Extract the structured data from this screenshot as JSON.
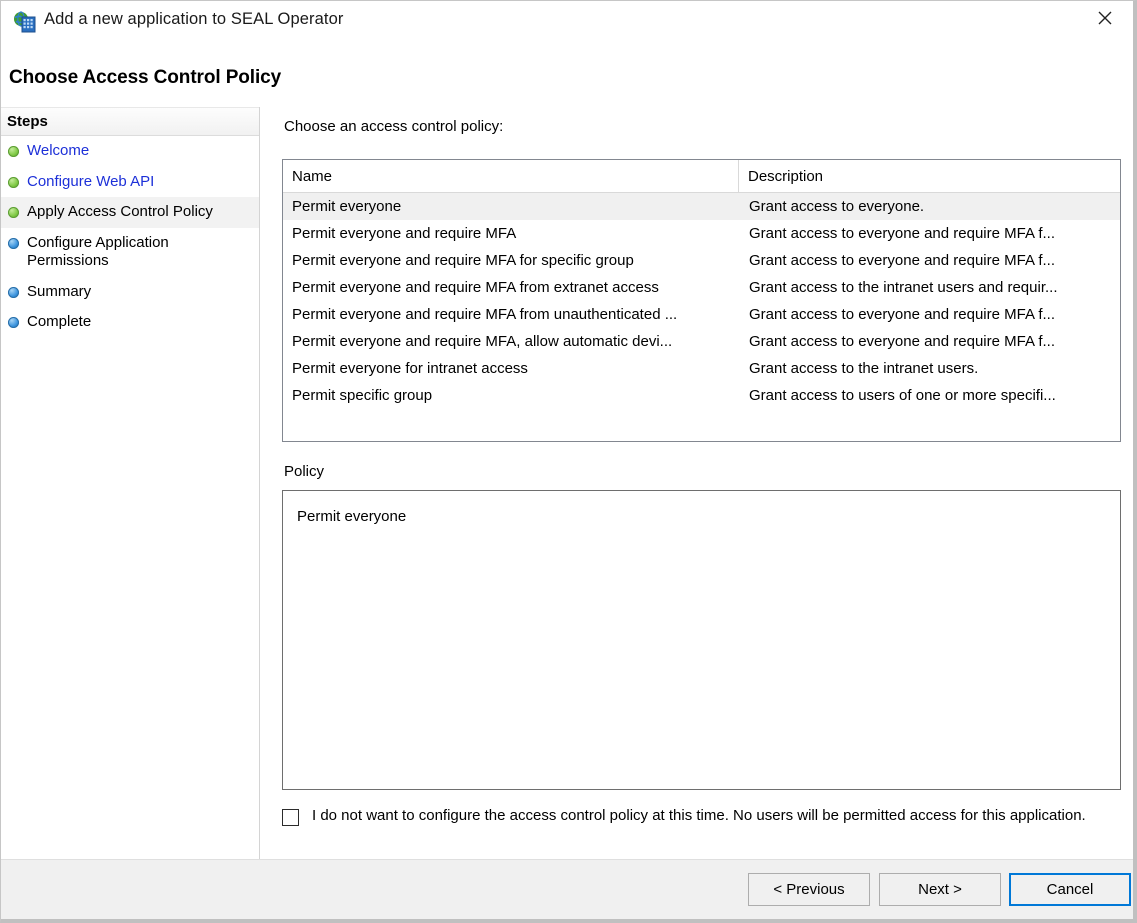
{
  "window": {
    "title": "Add a new application to SEAL Operator",
    "icon": "web-application-icon",
    "close_label": "✕",
    "heading": "Choose Access Control Policy"
  },
  "sidebar": {
    "header": "Steps",
    "items": [
      {
        "label": "Welcome",
        "state": "done",
        "link": true,
        "current": false
      },
      {
        "label": "Configure Web API",
        "state": "done",
        "link": true,
        "current": false
      },
      {
        "label": "Apply Access Control Policy",
        "state": "done",
        "link": false,
        "current": true
      },
      {
        "label": "Configure Application Permissions",
        "state": "todo",
        "link": false,
        "current": false
      },
      {
        "label": "Summary",
        "state": "todo",
        "link": false,
        "current": false
      },
      {
        "label": "Complete",
        "state": "todo",
        "link": false,
        "current": false
      }
    ]
  },
  "main": {
    "choose_label": "Choose an access control policy:",
    "columns": {
      "name": "Name",
      "description": "Description"
    },
    "rows": [
      {
        "name": "Permit everyone",
        "description": "Grant access to everyone.",
        "selected": true
      },
      {
        "name": "Permit everyone and require MFA",
        "description": "Grant access to everyone and require MFA f...",
        "selected": false
      },
      {
        "name": "Permit everyone and require MFA for specific group",
        "description": "Grant access to everyone and require MFA f...",
        "selected": false
      },
      {
        "name": "Permit everyone and require MFA from extranet access",
        "description": "Grant access to the intranet users and requir...",
        "selected": false
      },
      {
        "name": "Permit everyone and require MFA from unauthenticated ...",
        "description": "Grant access to everyone and require MFA f...",
        "selected": false
      },
      {
        "name": "Permit everyone and require MFA, allow automatic devi...",
        "description": "Grant access to everyone and require MFA f...",
        "selected": false
      },
      {
        "name": "Permit everyone for intranet access",
        "description": "Grant access to the intranet users.",
        "selected": false
      },
      {
        "name": "Permit specific group",
        "description": "Grant access to users of one or more specifi...",
        "selected": false
      }
    ],
    "policy_caption": "Policy",
    "policy_text": "Permit everyone",
    "optout_label": "I do not want to configure the access control policy at this time.  No users will be permitted access for this application.",
    "optout_checked": false
  },
  "footer": {
    "previous": "< Previous",
    "next": "Next >",
    "cancel": "Cancel"
  },
  "colors": {
    "link": "#1d30d8",
    "focus_border": "#0078d7",
    "selected_row": "#f0f0f0",
    "step_done": "#7fc944",
    "step_todo": "#3b93dd"
  }
}
